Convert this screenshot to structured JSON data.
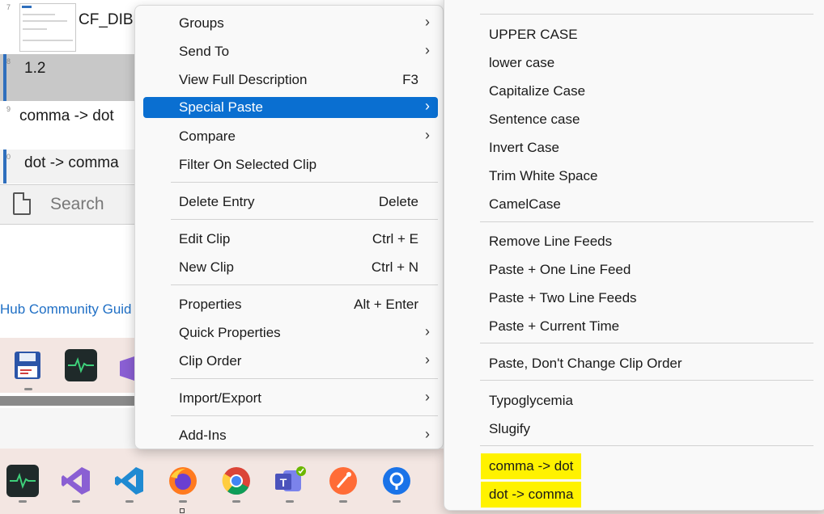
{
  "clip_list": {
    "rows": [
      {
        "num": "7",
        "text": "CF_DIB"
      },
      {
        "num": "8",
        "text": "1.2"
      },
      {
        "num": "9",
        "text": "comma -> dot"
      },
      {
        "num": "0",
        "text": "dot -> comma"
      }
    ],
    "search_placeholder": "Search",
    "hub_link": "Hub Community Guid"
  },
  "context_menu": {
    "items": [
      {
        "label": "Groups",
        "shortcut": "",
        "submenu": true
      },
      {
        "label": "Send To",
        "shortcut": "",
        "submenu": true
      },
      {
        "label": "View Full Description",
        "shortcut": "F3",
        "submenu": false
      },
      {
        "label": "Special Paste",
        "shortcut": "",
        "submenu": true,
        "selected": true
      },
      {
        "label": "Compare",
        "shortcut": "",
        "submenu": true
      },
      {
        "label": "Filter On Selected Clip",
        "shortcut": "",
        "submenu": false
      },
      {
        "label": "Delete Entry",
        "shortcut": "Delete",
        "submenu": false
      },
      {
        "label": "Edit Clip",
        "shortcut": "Ctrl + E",
        "submenu": false
      },
      {
        "label": "New Clip",
        "shortcut": "Ctrl + N",
        "submenu": false
      },
      {
        "label": "Properties",
        "shortcut": "Alt + Enter",
        "submenu": false
      },
      {
        "label": "Quick Properties",
        "shortcut": "",
        "submenu": true
      },
      {
        "label": "Clip Order",
        "shortcut": "",
        "submenu": true
      },
      {
        "label": "Import/Export",
        "shortcut": "",
        "submenu": true
      },
      {
        "label": "Add-Ins",
        "shortcut": "",
        "submenu": true
      }
    ],
    "chevron": "›"
  },
  "special_paste_submenu": {
    "items": [
      {
        "label": "UPPER CASE"
      },
      {
        "label": "lower case"
      },
      {
        "label": "Capitalize Case"
      },
      {
        "label": "Sentence case"
      },
      {
        "label": "Invert Case"
      },
      {
        "label": "Trim White Space"
      },
      {
        "label": "CamelCase"
      },
      {
        "label": "Remove Line Feeds"
      },
      {
        "label": "Paste + One Line Feed"
      },
      {
        "label": "Paste + Two Line Feeds"
      },
      {
        "label": "Paste + Current Time"
      },
      {
        "label": "Paste, Don't Change Clip Order"
      },
      {
        "label": "Typoglycemia"
      },
      {
        "label": "Slugify"
      },
      {
        "label": "comma -> dot",
        "highlighted": true
      },
      {
        "label": "dot -> comma",
        "highlighted": true
      }
    ]
  },
  "taskbar": {
    "icons": [
      "activity-monitor-icon",
      "visual-studio-icon",
      "vscode-icon",
      "firefox-icon",
      "chrome-icon",
      "teams-icon",
      "postman-icon",
      "pin-app-icon"
    ],
    "colors": {
      "highlight": "#fff200",
      "selection": "#0a6fd1",
      "taskbar_bg": "#f3e6e2"
    }
  }
}
